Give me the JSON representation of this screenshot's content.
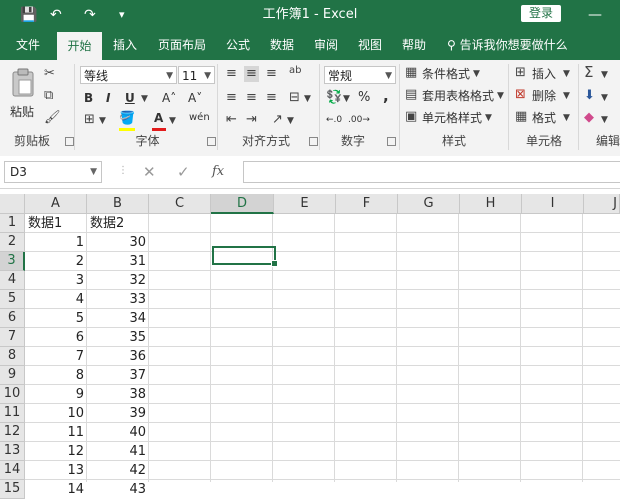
{
  "titlebar": {
    "title": "工作簿1  -  Excel",
    "login_label": "登录",
    "save_icon": "💾",
    "undo_icon": "↶",
    "redo_icon": "↷",
    "customize_icon": "▾",
    "minimize_icon": "—"
  },
  "tabs": [
    {
      "label": "文件",
      "active": false
    },
    {
      "label": "开始",
      "active": true
    },
    {
      "label": "插入",
      "active": false
    },
    {
      "label": "页面布局",
      "active": false
    },
    {
      "label": "公式",
      "active": false
    },
    {
      "label": "数据",
      "active": false
    },
    {
      "label": "审阅",
      "active": false
    },
    {
      "label": "视图",
      "active": false
    },
    {
      "label": "帮助",
      "active": false
    }
  ],
  "tellme": {
    "label": "告诉我你想要做什么"
  },
  "ribbon": {
    "clipboard": {
      "paste_label": "粘贴",
      "group_label": "剪贴板"
    },
    "font": {
      "font_name": "等线",
      "font_size": "11",
      "bold": "B",
      "italic": "I",
      "underline": "U",
      "grow": "A˄",
      "shrink": "A˅",
      "font_color": "A",
      "phonetic": "wén",
      "group_label": "字体"
    },
    "alignment": {
      "group_label": "对齐方式",
      "wrap_icon": "ab"
    },
    "number": {
      "format": "常规",
      "percent": "%",
      "comma": ",",
      "increase_decimal": "←.0",
      "decrease_decimal": ".00→",
      "group_label": "数字"
    },
    "styles": {
      "conditional": "条件格式",
      "table_format": "套用表格格式",
      "cell_styles": "单元格样式",
      "group_label": "样式"
    },
    "cells": {
      "insert": "插入",
      "delete": "删除",
      "format": "格式",
      "group_label": "单元格"
    },
    "editing": {
      "sum_icon": "Σ",
      "group_label": "编辑"
    }
  },
  "formula_bar": {
    "name_box": "D3",
    "cancel": "✕",
    "enter": "✓",
    "fx": "fx",
    "value": ""
  },
  "grid": {
    "columns": [
      "A",
      "B",
      "C",
      "D",
      "E",
      "F",
      "G",
      "H",
      "I",
      "J"
    ],
    "selected_column": "D",
    "rows": [
      "1",
      "2",
      "3",
      "4",
      "5",
      "6",
      "7",
      "8",
      "9",
      "10",
      "11",
      "12",
      "13",
      "14",
      "15"
    ],
    "selected_row": "3",
    "header_a": "数据1",
    "header_b": "数据2",
    "values_a": [
      "1",
      "2",
      "3",
      "4",
      "5",
      "6",
      "7",
      "8",
      "9",
      "10",
      "11",
      "12",
      "13",
      "14"
    ],
    "values_b": [
      "30",
      "31",
      "32",
      "33",
      "34",
      "35",
      "36",
      "37",
      "38",
      "39",
      "40",
      "41",
      "42",
      "43"
    ],
    "selected_cell": "D3"
  }
}
